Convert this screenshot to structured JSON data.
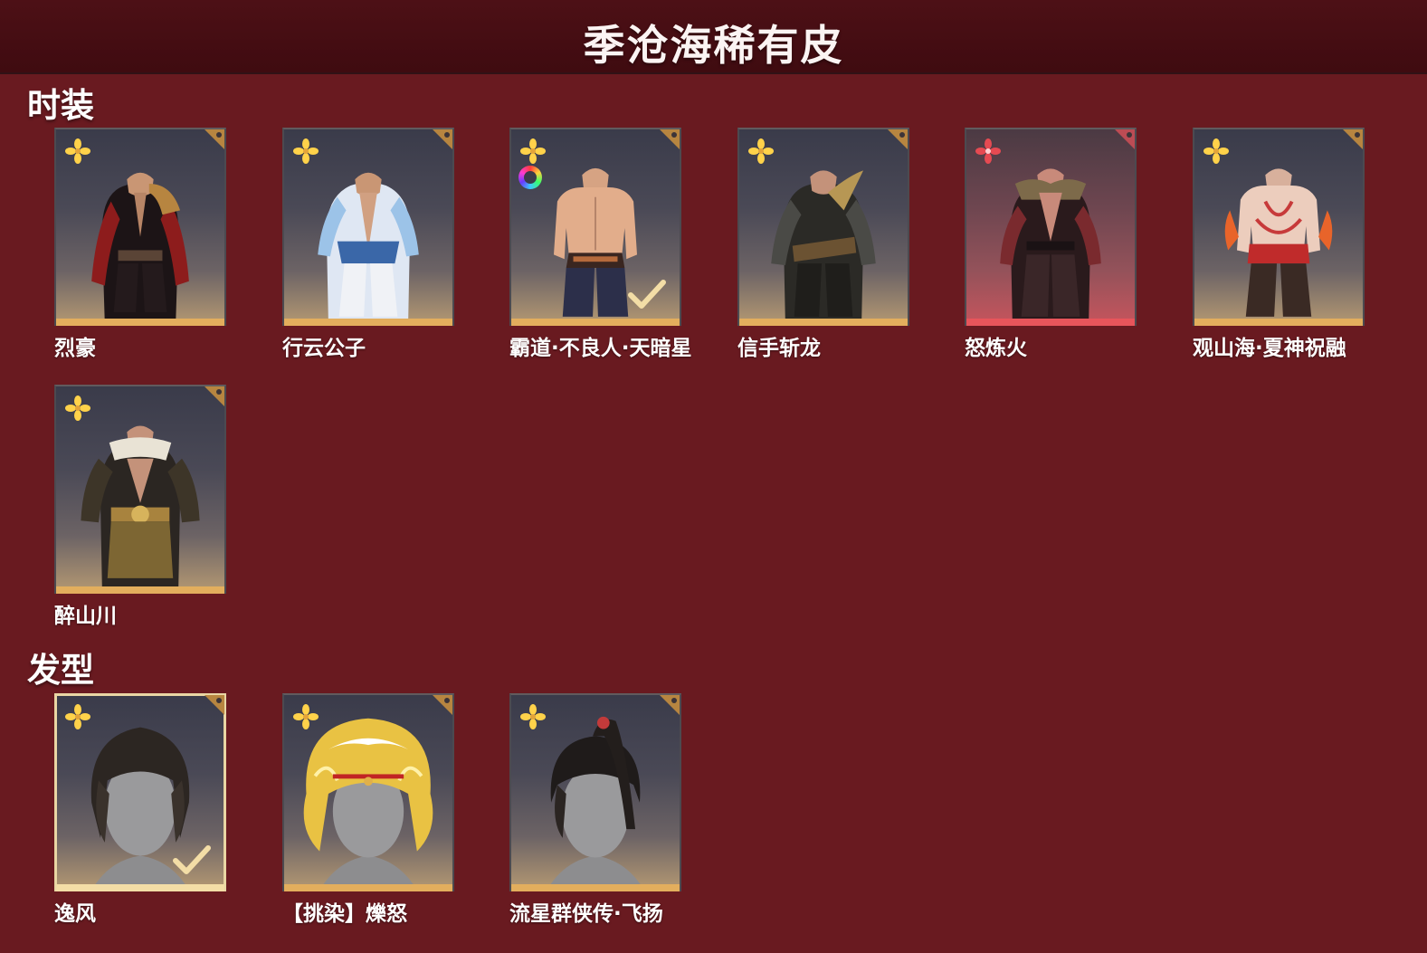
{
  "header": {
    "title": "季沧海稀有皮"
  },
  "sections": {
    "outfits": {
      "title": "时装",
      "items": [
        {
          "label": "烈豪",
          "rarity_color": "#ffd24a",
          "selected": false
        },
        {
          "label": "行云公子",
          "rarity_color": "#ffd24a",
          "selected": false
        },
        {
          "label": "霸道·不良人·天暗星",
          "rarity_color": "#ffd24a",
          "selected": true,
          "dye": true
        },
        {
          "label": "信手斩龙",
          "rarity_color": "#ffd24a",
          "selected": false
        },
        {
          "label": "怒炼火",
          "rarity_color": "#e64a52",
          "selected": false
        },
        {
          "label": "观山海·夏神祝融",
          "rarity_color": "#ffd24a",
          "selected": false
        },
        {
          "label": "醉山川",
          "rarity_color": "#ffd24a",
          "selected": false
        }
      ]
    },
    "hairstyles": {
      "title": "发型",
      "items": [
        {
          "label": "逸风",
          "rarity_color": "#ffd24a",
          "selected": true
        },
        {
          "label": "【挑染】爍怒",
          "rarity_color": "#ffd24a",
          "selected": false
        },
        {
          "label": "流星群侠传·飞扬",
          "rarity_color": "#ffd24a",
          "selected": false
        }
      ]
    }
  },
  "colors": {
    "background": "#691a20",
    "header": "#3f0b10",
    "gold_rarity": "#e3ae5d",
    "red_rarity": "#e8555b"
  }
}
